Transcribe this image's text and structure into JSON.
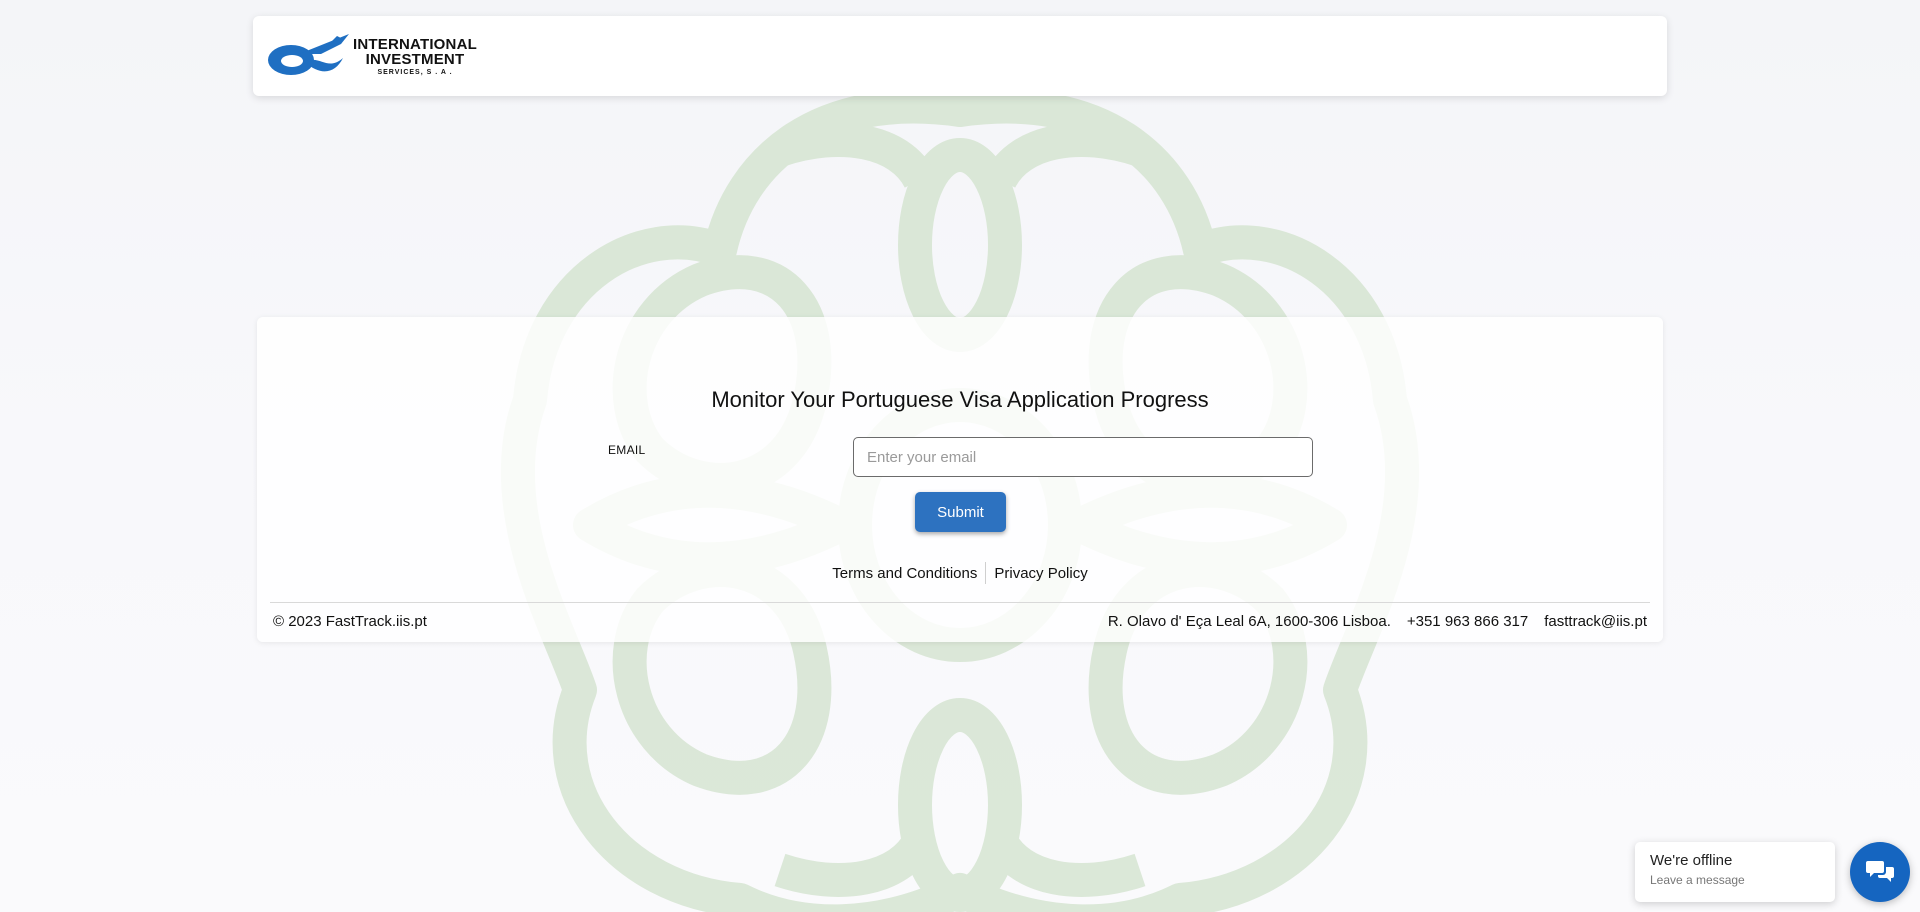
{
  "header": {
    "logo": {
      "line1": "INTERNATIONAL",
      "line2": "INVESTMENT",
      "line3": "SERVICES, S . A ."
    }
  },
  "form": {
    "title": "Monitor Your Portuguese Visa Application Progress",
    "email_label": "EMAIL",
    "email_placeholder": "Enter your email",
    "email_value": "",
    "submit_label": "Submit"
  },
  "links": {
    "terms": "Terms and Conditions",
    "privacy": "Privacy Policy"
  },
  "footer": {
    "copyright": "© 2023 FastTrack.iis.pt",
    "address": "R. Olavo d' Eça Leal 6A, 1600-306 Lisboa.",
    "phone": "+351 963 866 317",
    "email": "fasttrack@iis.pt"
  },
  "chat": {
    "status": "We're offline",
    "action": "Leave a message",
    "icon": "chat-bubbles-icon"
  },
  "colors": {
    "accent": "#2d72c0",
    "chat_button": "#1565c0",
    "watermark": "#d3e4cf",
    "logo_blue": "#1f6fc2"
  }
}
